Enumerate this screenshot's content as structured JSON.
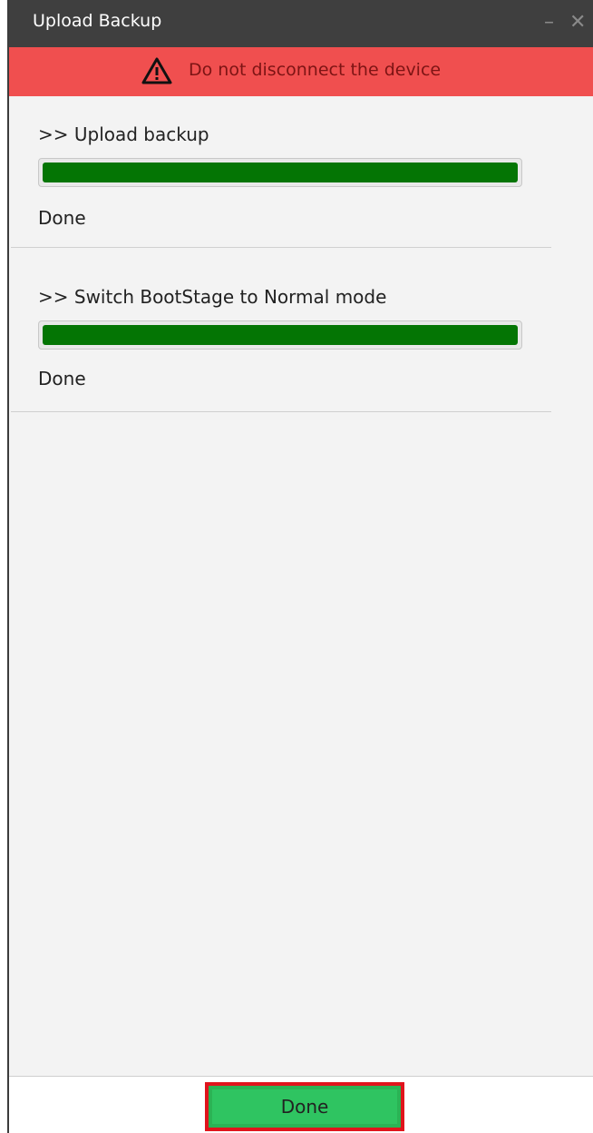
{
  "window": {
    "title": "Upload Backup",
    "minimize_glyph": "–",
    "close_glyph": "✕"
  },
  "warning": {
    "text": "Do not disconnect the device",
    "icon": "warning-triangle-icon",
    "background": "#f04f4f"
  },
  "steps": [
    {
      "title": ">> Upload backup",
      "progress_percent": 100,
      "status": "Done"
    },
    {
      "title": ">> Switch BootStage to Normal mode",
      "progress_percent": 100,
      "status": "Done"
    }
  ],
  "footer": {
    "done_label": "Done",
    "accent": "#2fc461"
  }
}
